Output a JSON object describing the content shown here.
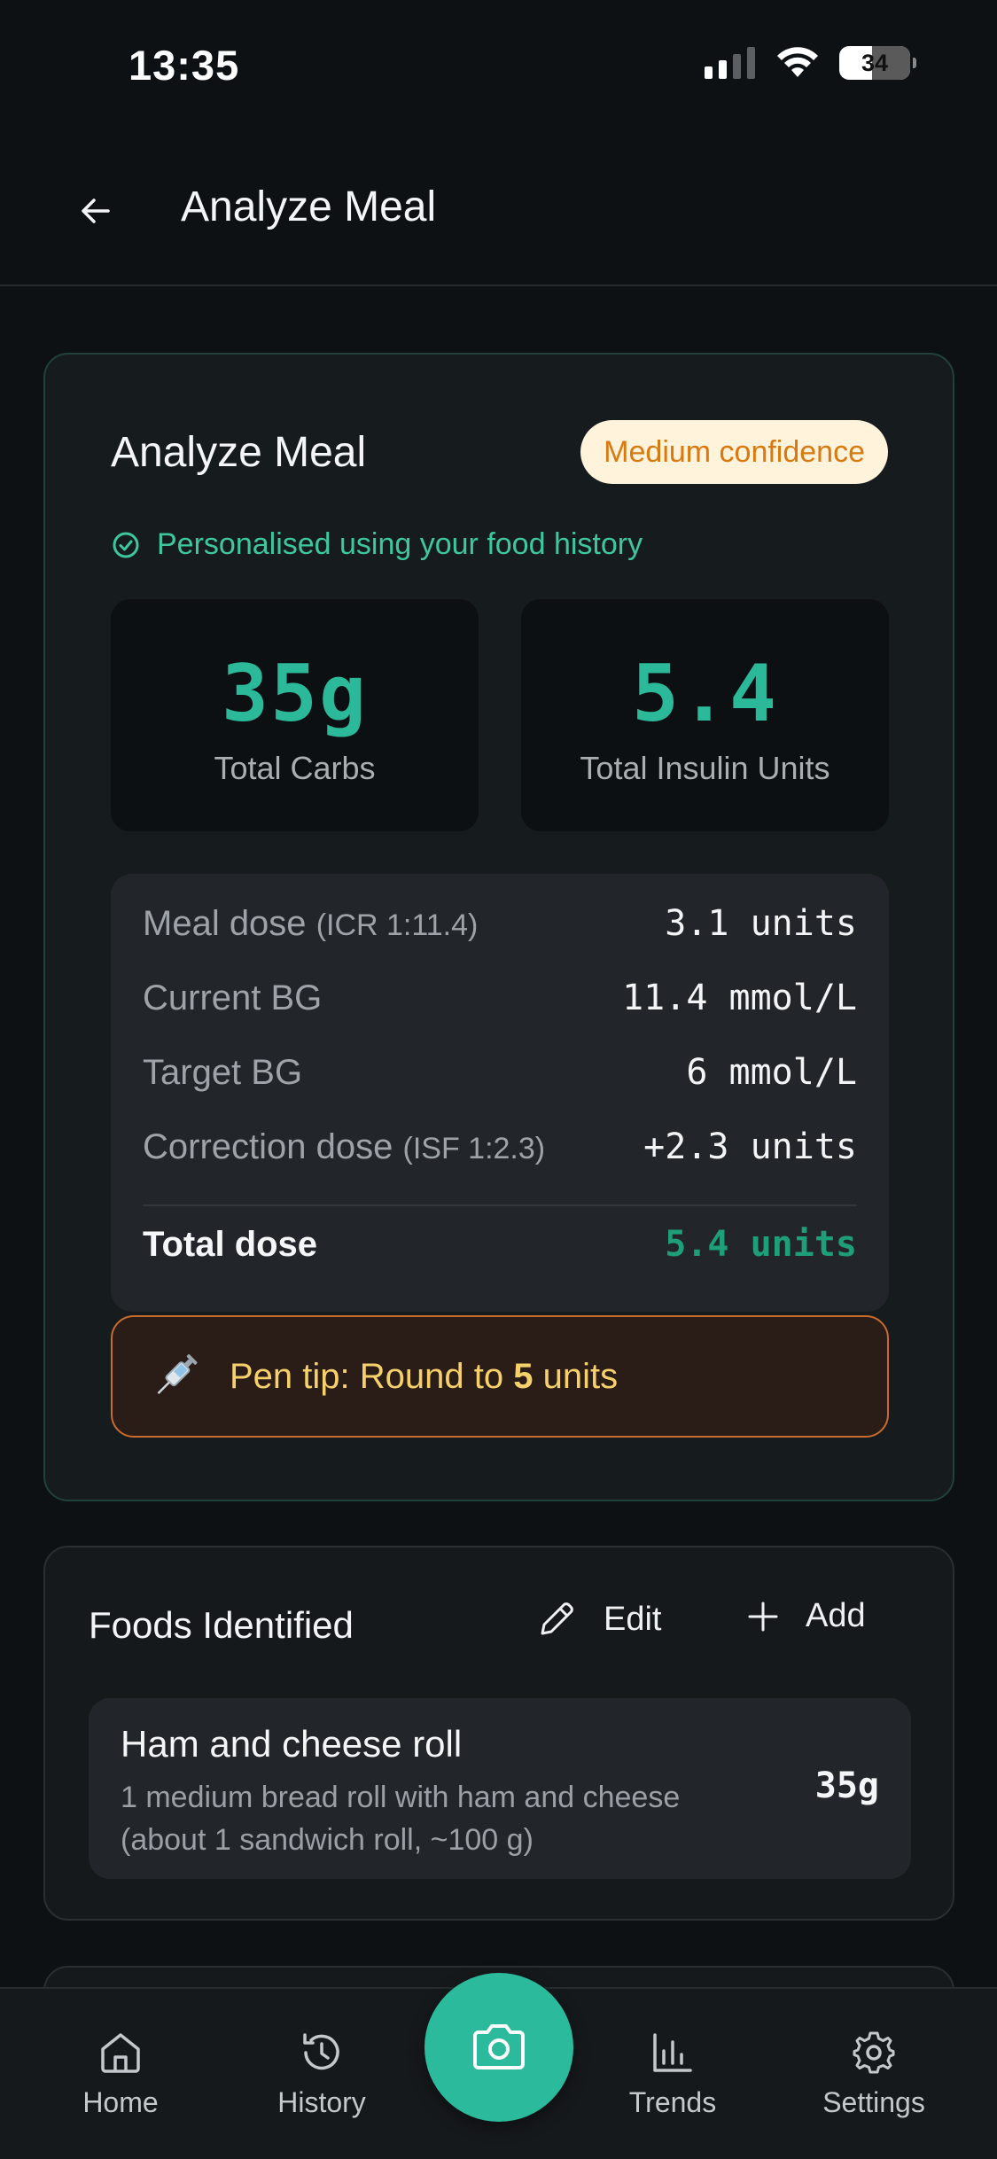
{
  "status_bar": {
    "time": "13:35",
    "battery": "34"
  },
  "header": {
    "title": "Analyze Meal"
  },
  "analysis": {
    "title": "Analyze Meal",
    "confidence": "Medium confidence",
    "personal_note": "Personalised using your food history",
    "total_carbs": {
      "value": "35g",
      "label": "Total Carbs"
    },
    "total_insulin": {
      "value": "5.4",
      "label": "Total Insulin Units"
    },
    "dose": {
      "meal_label": "Meal dose",
      "meal_sub": "(ICR 1:11.4)",
      "meal_value": "3.1 units",
      "current_bg_label": "Current BG",
      "current_bg_value": "11.4 mmol/L",
      "target_bg_label": "Target BG",
      "target_bg_value": "6 mmol/L",
      "correction_label": "Correction dose",
      "correction_sub": "(ISF 1:2.3)",
      "correction_value": "+2.3 units",
      "total_label": "Total dose",
      "total_value": "5.4 units"
    },
    "pen_tip": {
      "prefix": "Pen tip: Round to",
      "amount": "5",
      "suffix": "units"
    }
  },
  "foods": {
    "title": "Foods Identified",
    "edit_label": "Edit",
    "add_label": "Add",
    "items": [
      {
        "name": "Ham and cheese roll",
        "description": "1 medium bread roll with ham and cheese (about 1 sandwich roll, ~100 g)",
        "carbs": "35g"
      }
    ]
  },
  "tab_bar": {
    "home": "Home",
    "history": "History",
    "trends": "Trends",
    "settings": "Settings"
  },
  "colors": {
    "accent": "#2bbb9c",
    "badge_bg": "#fff3dc",
    "badge_text": "#d9790f",
    "pen_tip_border": "#c96b2c",
    "pen_tip_text": "#f6d06a"
  }
}
